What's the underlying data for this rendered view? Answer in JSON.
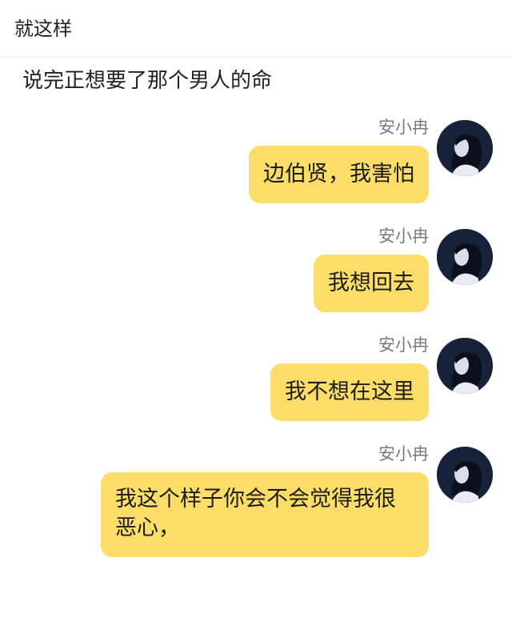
{
  "header": {
    "title": "就这样"
  },
  "intro": {
    "text": "说完正想要了那个男人的命"
  },
  "messages": [
    {
      "sender": "安小冉",
      "text": "边伯贤，我害怕"
    },
    {
      "sender": "安小冉",
      "text": "我想回去"
    },
    {
      "sender": "安小冉",
      "text": "我不想在这里"
    },
    {
      "sender": "安小冉",
      "text": "我这个样子你会不会觉得我很恶心，"
    }
  ],
  "colors": {
    "bubble": "#fbdd68",
    "sender": "#7a7a7a",
    "avatar_bg": "#1b2740"
  },
  "icons": {
    "avatar": "girl-profile-avatar-icon"
  }
}
